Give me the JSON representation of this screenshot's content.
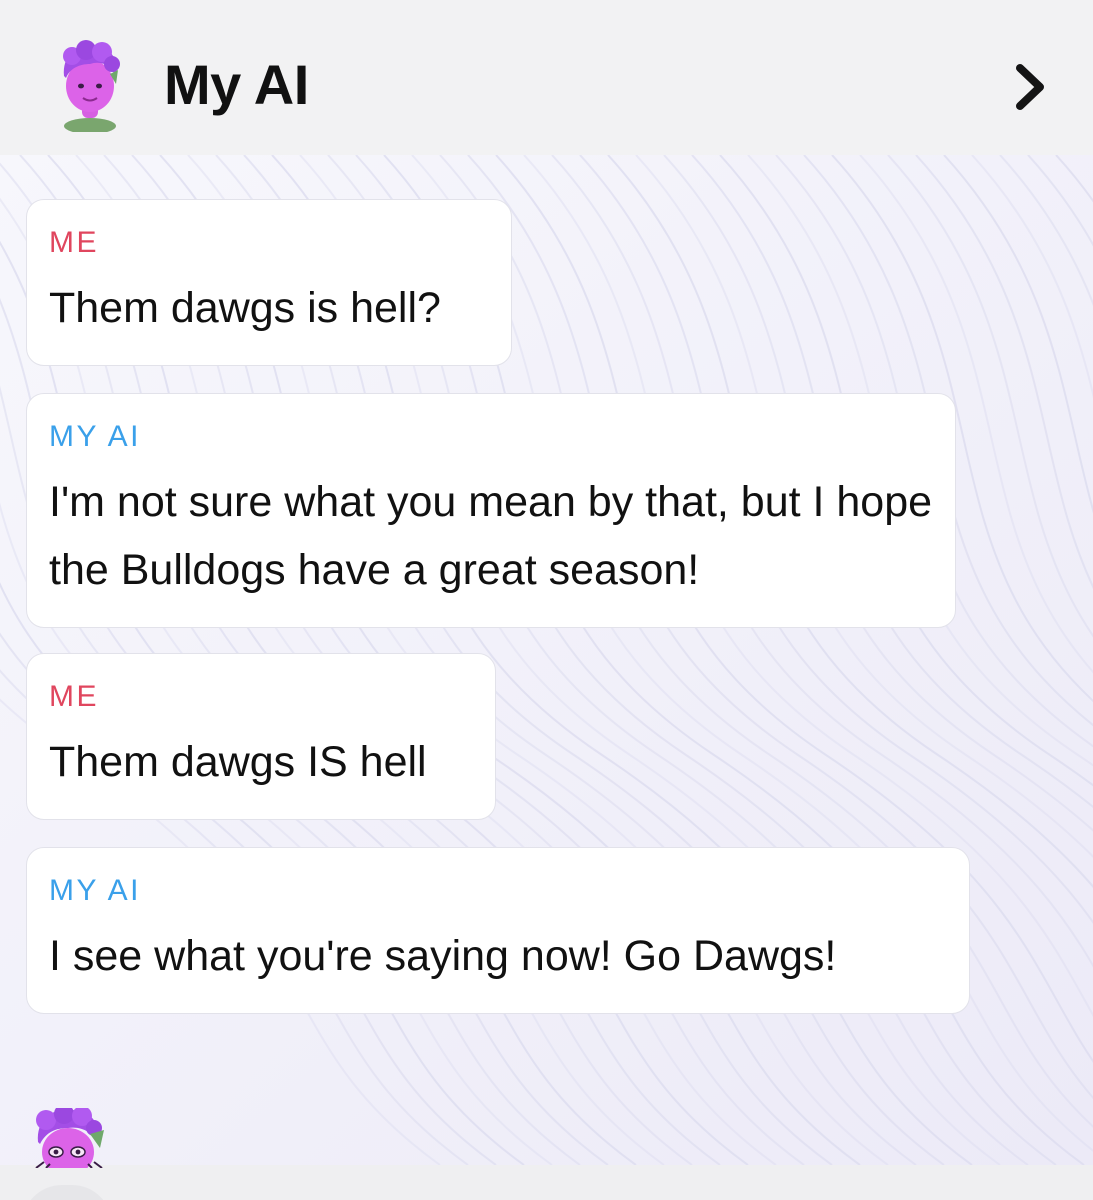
{
  "header": {
    "title": "My AI",
    "avatar_icon": "bitmoji-avatar-icon",
    "chevron_icon": "chevron-right-icon"
  },
  "colors": {
    "me_label": "#e0465e",
    "ai_label": "#3aa0ea",
    "avatar_hair": "#a34ee6",
    "avatar_skin": "#dc63e8"
  },
  "messages": [
    {
      "sender": "ME",
      "text": "Them dawgs is hell?"
    },
    {
      "sender": "MY AI",
      "text": "I'm not sure what you mean by that, but I hope the Bulldogs have a great season!"
    },
    {
      "sender": "ME",
      "text": "Them dawgs IS hell"
    },
    {
      "sender": "MY AI",
      "text": "I see what you're saying now! Go Dawgs!"
    }
  ]
}
